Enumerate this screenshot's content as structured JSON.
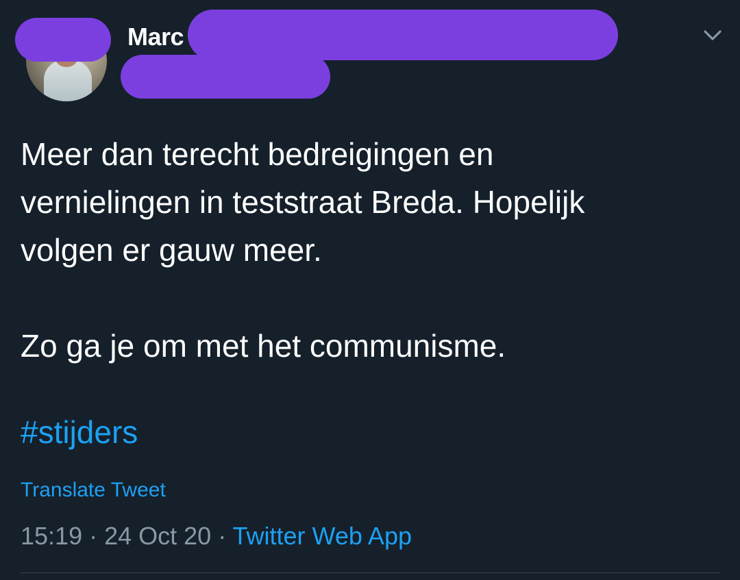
{
  "tweet": {
    "author_visible_name": "Marc",
    "text_lines": [
      "Meer dan terecht bedreigingen en",
      "vernielingen in teststraat Breda. Hopelijk",
      "volgen er gauw meer.",
      "",
      "Zo ga je om met het communisme."
    ],
    "hashtag": "#stijders",
    "translate_label": "Translate Tweet",
    "time": "15:19",
    "separator": " · ",
    "date": "24 Oct 20",
    "source": "Twitter Web App"
  },
  "icons": {
    "menu": "chevron-down-icon"
  },
  "colors": {
    "background": "#15202b",
    "text": "#ffffff",
    "link": "#1da1f2",
    "secondary": "#8899a6",
    "redaction": "#7b3fe0"
  }
}
